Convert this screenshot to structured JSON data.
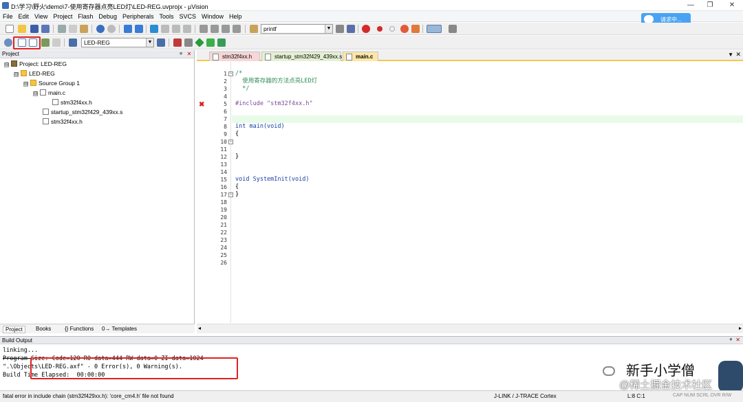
{
  "window": {
    "title": "D:\\学习\\野火\\demo\\7-使用寄存器点亮LED灯\\LED-REG.uvprojx - µVision",
    "min": "—",
    "max": "❐",
    "close": "✕"
  },
  "menu": [
    "File",
    "Edit",
    "View",
    "Project",
    "Flash",
    "Debug",
    "Peripherals",
    "Tools",
    "SVCS",
    "Window",
    "Help"
  ],
  "cloud_button": {
    "label": "请求中..."
  },
  "toolbar1": {
    "find_value": "printf"
  },
  "toolbar2": {
    "target_value": "LED-REG"
  },
  "project_panel": {
    "header": "Project",
    "tree": [
      {
        "label": "Project: LED-REG",
        "expander": "⊟",
        "kind": "project"
      },
      {
        "label": "LED-REG",
        "expander": "⊟",
        "kind": "target"
      },
      {
        "label": "Source Group 1",
        "expander": "⊟",
        "kind": "folder"
      },
      {
        "label": "main.c",
        "expander": "⊟",
        "kind": "file"
      },
      {
        "label": "stm32f4xx.h",
        "expander": "",
        "kind": "file"
      },
      {
        "label": "startup_stm32f429_439xx.s",
        "expander": "",
        "kind": "file"
      },
      {
        "label": "stm32f4xx.h",
        "expander": "",
        "kind": "file"
      }
    ],
    "bottom_tabs": [
      "Project",
      "Books",
      "{} Functions",
      "0→ Templates"
    ]
  },
  "editor": {
    "tabs": [
      "stm32f4xx.h",
      "startup_stm32f429_439xx.s",
      "main.c"
    ],
    "active_tab": 2,
    "error_marker": "✖",
    "lines": [
      {
        "n": "1",
        "t": ""
      },
      {
        "n": "2",
        "t": "/*"
      },
      {
        "n": "3",
        "t": "  使用寄存器的方法点亮LED灯"
      },
      {
        "n": "4",
        "t": "  */"
      },
      {
        "n": "5",
        "t": ""
      },
      {
        "n": "6",
        "t": "#include \"stm32f4xx.h\""
      },
      {
        "n": "7",
        "t": ""
      },
      {
        "n": "8",
        "t": ""
      },
      {
        "n": "9",
        "t": "int main(void)"
      },
      {
        "n": "10",
        "t": "{"
      },
      {
        "n": "11",
        "t": ""
      },
      {
        "n": "12",
        "t": ""
      },
      {
        "n": "13",
        "t": "}"
      },
      {
        "n": "14",
        "t": ""
      },
      {
        "n": "15",
        "t": ""
      },
      {
        "n": "16",
        "t": "void SystemInit(void)"
      },
      {
        "n": "17",
        "t": "{"
      },
      {
        "n": "18",
        "t": "}"
      },
      {
        "n": "19",
        "t": ""
      },
      {
        "n": "20",
        "t": ""
      },
      {
        "n": "21",
        "t": ""
      },
      {
        "n": "22",
        "t": ""
      },
      {
        "n": "23",
        "t": ""
      },
      {
        "n": "24",
        "t": ""
      },
      {
        "n": "25",
        "t": ""
      },
      {
        "n": "26",
        "t": ""
      }
    ]
  },
  "build_output": {
    "header": "Build Output",
    "lines": [
      "linking...",
      "Program Size: Code=120 RO-data=444 RW-data=0 ZI-data=1024",
      "\".\\Objects\\LED-REG.axf\" - 0 Error(s), 0 Warning(s).",
      "Build Time Elapsed:  00:00:00"
    ]
  },
  "status": {
    "message": "fatal error in include chain (stm32f429xx.h): 'core_cm4.h' file not found",
    "debugger": "J-LINK / J-TRACE Cortex",
    "position": "L:8 C:1",
    "flags": "CAP NUM SCRL OVR R/W"
  },
  "watermark": {
    "name": "新手小学僧",
    "sub": "@稀土掘金技术社区"
  }
}
